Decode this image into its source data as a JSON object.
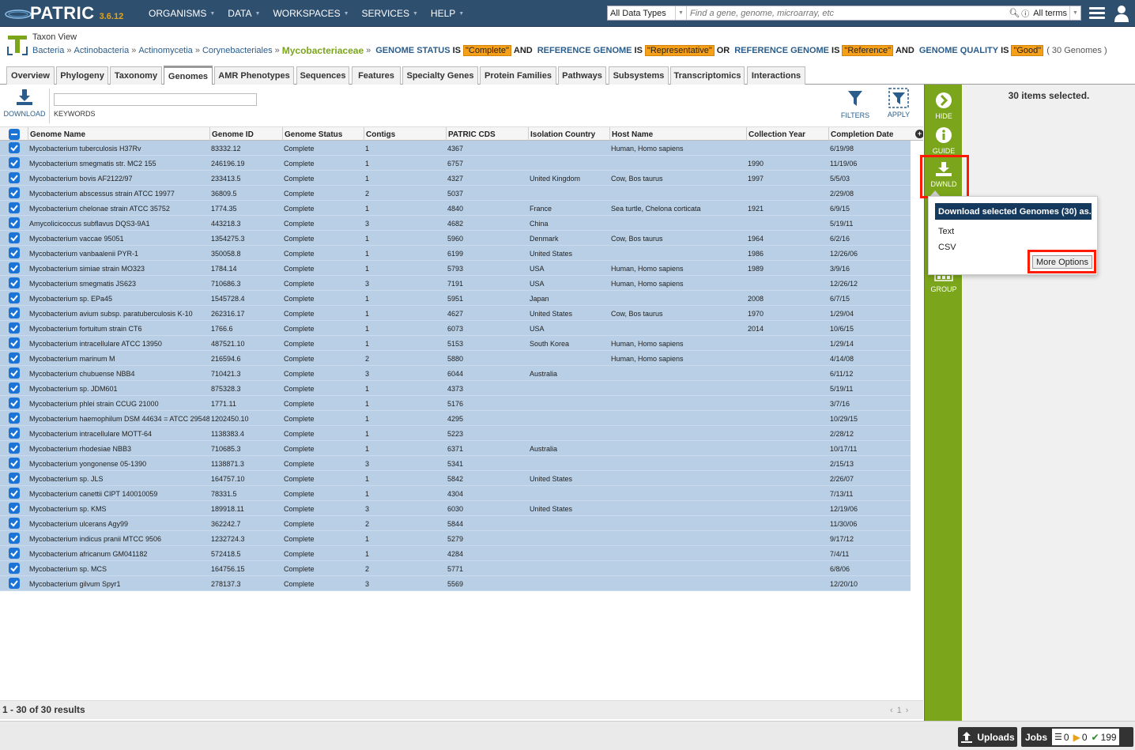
{
  "app": {
    "name": "PATRIC",
    "version": "3.6.12"
  },
  "topnav": {
    "menu": [
      {
        "label": "ORGANISMS"
      },
      {
        "label": "DATA"
      },
      {
        "label": "WORKSPACES"
      },
      {
        "label": "SERVICES"
      },
      {
        "label": "HELP"
      }
    ],
    "search": {
      "data_type": "All Data Types",
      "placeholder": "Find a gene, genome, microarray, etc",
      "terms": "All terms"
    }
  },
  "header": {
    "view_title": "Taxon View",
    "breadcrumb": [
      "Bacteria",
      "Actinobacteria",
      "Actinomycetia",
      "Corynebacteriales"
    ],
    "current": "Mycobacteriaceae",
    "filters": [
      {
        "key": "GENOME STATUS",
        "value": "\"Complete\"",
        "join": "AND"
      },
      {
        "key": "REFERENCE GENOME",
        "value": "\"Representative\"",
        "join": "OR"
      },
      {
        "key": "REFERENCE GENOME",
        "value": "\"Reference\"",
        "join": "AND"
      },
      {
        "key": "GENOME QUALITY",
        "value": "\"Good\"",
        "join": ""
      }
    ],
    "is_word": "IS",
    "count": "( 30 Genomes )"
  },
  "tabs": [
    {
      "label": "Overview"
    },
    {
      "label": "Phylogeny"
    },
    {
      "label": "Taxonomy"
    },
    {
      "label": "Genomes",
      "active": true
    },
    {
      "label": "AMR Phenotypes"
    },
    {
      "label": "Sequences"
    },
    {
      "label": "Features"
    },
    {
      "label": "Specialty Genes"
    },
    {
      "label": "Protein Families"
    },
    {
      "label": "Pathways"
    },
    {
      "label": "Subsystems"
    },
    {
      "label": "Transcriptomics"
    },
    {
      "label": "Interactions"
    }
  ],
  "toolbar": {
    "download": "DOWNLOAD",
    "keywords": "KEYWORDS",
    "keywords_value": "",
    "filters": "FILTERS",
    "apply": "APPLY"
  },
  "grid": {
    "columns": [
      "Genome Name",
      "Genome ID",
      "Genome Status",
      "Contigs",
      "PATRIC CDS",
      "Isolation Country",
      "Host Name",
      "Collection Year",
      "Completion Date"
    ],
    "rows": [
      [
        "Mycobacterium tuberculosis H37Rv",
        "83332.12",
        "Complete",
        "1",
        "4367",
        "",
        "Human, Homo sapiens",
        "",
        "6/19/98"
      ],
      [
        "Mycobacterium smegmatis str. MC2 155",
        "246196.19",
        "Complete",
        "1",
        "6757",
        "",
        "",
        "1990",
        "11/19/06"
      ],
      [
        "Mycobacterium bovis AF2122/97",
        "233413.5",
        "Complete",
        "1",
        "4327",
        "United Kingdom",
        "Cow, Bos taurus",
        "1997",
        "5/5/03"
      ],
      [
        "Mycobacterium abscessus strain ATCC 19977",
        "36809.5",
        "Complete",
        "2",
        "5037",
        "",
        "",
        "",
        "2/29/08"
      ],
      [
        "Mycobacterium chelonae strain ATCC 35752",
        "1774.35",
        "Complete",
        "1",
        "4840",
        "France",
        "Sea turtle, Chelona corticata",
        "1921",
        "6/9/15"
      ],
      [
        "Amycolicicoccus subflavus DQS3-9A1",
        "443218.3",
        "Complete",
        "3",
        "4682",
        "China",
        "",
        "",
        "5/19/11"
      ],
      [
        "Mycobacterium vaccae 95051",
        "1354275.3",
        "Complete",
        "1",
        "5960",
        "Denmark",
        "Cow, Bos taurus",
        "1964",
        "6/2/16"
      ],
      [
        "Mycobacterium vanbaalenii PYR-1",
        "350058.8",
        "Complete",
        "1",
        "6199",
        "United States",
        "",
        "1986",
        "12/26/06"
      ],
      [
        "Mycobacterium simiae strain MO323",
        "1784.14",
        "Complete",
        "1",
        "5793",
        "USA",
        "Human, Homo sapiens",
        "1989",
        "3/9/16"
      ],
      [
        "Mycobacterium smegmatis JS623",
        "710686.3",
        "Complete",
        "3",
        "7191",
        "USA",
        "Human, Homo sapiens",
        "",
        "12/26/12"
      ],
      [
        "Mycobacterium sp. EPa45",
        "1545728.4",
        "Complete",
        "1",
        "5951",
        "Japan",
        "",
        "2008",
        "6/7/15"
      ],
      [
        "Mycobacterium avium subsp. paratuberculosis K-10",
        "262316.17",
        "Complete",
        "1",
        "4627",
        "United States",
        "Cow, Bos taurus",
        "1970",
        "1/29/04"
      ],
      [
        "Mycobacterium fortuitum strain CT6",
        "1766.6",
        "Complete",
        "1",
        "6073",
        "USA",
        "",
        "2014",
        "10/6/15"
      ],
      [
        "Mycobacterium intracellulare ATCC 13950",
        "487521.10",
        "Complete",
        "1",
        "5153",
        "South Korea",
        "Human, Homo sapiens",
        "",
        "1/29/14"
      ],
      [
        "Mycobacterium marinum M",
        "216594.6",
        "Complete",
        "2",
        "5880",
        "",
        "Human, Homo sapiens",
        "",
        "4/14/08"
      ],
      [
        "Mycobacterium chubuense NBB4",
        "710421.3",
        "Complete",
        "3",
        "6044",
        "Australia",
        "",
        "",
        "6/11/12"
      ],
      [
        "Mycobacterium sp. JDM601",
        "875328.3",
        "Complete",
        "1",
        "4373",
        "",
        "",
        "",
        "5/19/11"
      ],
      [
        "Mycobacterium phlei strain CCUG 21000",
        "1771.11",
        "Complete",
        "1",
        "5176",
        "",
        "",
        "",
        "3/7/16"
      ],
      [
        "Mycobacterium haemophilum DSM 44634 = ATCC 29548",
        "1202450.10",
        "Complete",
        "1",
        "4295",
        "",
        "",
        "",
        "10/29/15"
      ],
      [
        "Mycobacterium intracellulare MOTT-64",
        "1138383.4",
        "Complete",
        "1",
        "5223",
        "",
        "",
        "",
        "2/28/12"
      ],
      [
        "Mycobacterium rhodesiae NBB3",
        "710685.3",
        "Complete",
        "1",
        "6371",
        "Australia",
        "",
        "",
        "10/17/11"
      ],
      [
        "Mycobacterium yongonense 05-1390",
        "1138871.3",
        "Complete",
        "3",
        "5341",
        "",
        "",
        "",
        "2/15/13"
      ],
      [
        "Mycobacterium sp. JLS",
        "164757.10",
        "Complete",
        "1",
        "5842",
        "United States",
        "",
        "",
        "2/26/07"
      ],
      [
        "Mycobacterium canettii CIPT 140010059",
        "78331.5",
        "Complete",
        "1",
        "4304",
        "",
        "",
        "",
        "7/13/11"
      ],
      [
        "Mycobacterium sp. KMS",
        "189918.11",
        "Complete",
        "3",
        "6030",
        "United States",
        "",
        "",
        "12/19/06"
      ],
      [
        "Mycobacterium ulcerans Agy99",
        "362242.7",
        "Complete",
        "2",
        "5844",
        "",
        "",
        "",
        "11/30/06"
      ],
      [
        "Mycobacterium indicus pranii MTCC 9506",
        "1232724.3",
        "Complete",
        "1",
        "5279",
        "",
        "",
        "",
        "9/17/12"
      ],
      [
        "Mycobacterium africanum GM041182",
        "572418.5",
        "Complete",
        "1",
        "4284",
        "",
        "",
        "",
        "7/4/11"
      ],
      [
        "Mycobacterium sp. MCS",
        "164756.15",
        "Complete",
        "2",
        "5771",
        "",
        "",
        "",
        "6/8/06"
      ],
      [
        "Mycobacterium gilvum Spyr1",
        "278137.3",
        "Complete",
        "3",
        "5569",
        "",
        "",
        "",
        "12/20/10"
      ]
    ],
    "result_count": "1 - 30 of 30 results",
    "page": "1"
  },
  "actions": {
    "hide": "HIDE",
    "guide": "GUIDE",
    "download": "DWNLD",
    "group": "GROUP"
  },
  "selection": {
    "message": "30 items selected."
  },
  "download_popup": {
    "title": "Download selected Genomes (30) as...",
    "options": [
      "Text",
      "CSV"
    ],
    "more": "More Options"
  },
  "bottombar": {
    "uploads": "Uploads",
    "jobs": "Jobs",
    "queued": "0",
    "running": "0",
    "completed": "199"
  },
  "colors": {
    "nav_bg": "#2f4f6f",
    "accent_green": "#7ba51b",
    "row_selected": "#b8cfe6",
    "filter_value_bg": "#f6a01a",
    "highlight_red": "#ff1a00"
  }
}
